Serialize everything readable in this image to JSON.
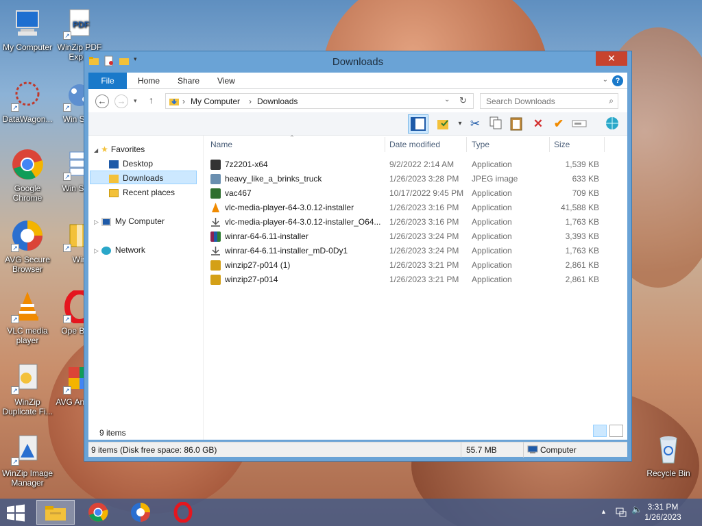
{
  "desktop": {
    "icons": [
      {
        "label": "My Computer",
        "icon": "computer-icon"
      },
      {
        "label": "WinZip PDF Expre",
        "icon": "pdf-icon"
      },
      {
        "label": "DataWagon...",
        "icon": "datawagon-icon"
      },
      {
        "label": "Win Safe",
        "icon": "winzip-safe-icon"
      },
      {
        "label": "Google Chrome",
        "icon": "chrome-icon"
      },
      {
        "label": "Win Secu",
        "icon": "winzip-secure-icon"
      },
      {
        "label": "AVG Secure Browser",
        "icon": "avg-browser-icon"
      },
      {
        "label": "Win",
        "icon": "winzip-icon"
      },
      {
        "label": "VLC media player",
        "icon": "vlc-icon"
      },
      {
        "label": "Ope Brow",
        "icon": "opera-icon"
      },
      {
        "label": "WinZip Duplicate Fi...",
        "icon": "winzip-duplicate-icon"
      },
      {
        "label": "AVG An FRE",
        "icon": "avg-antivirus-icon"
      },
      {
        "label": "WinZip Image Manager",
        "icon": "winzip-image-icon"
      },
      {
        "label": "Recycle Bin",
        "icon": "recycle-bin-icon"
      }
    ]
  },
  "window": {
    "title": "Downloads",
    "close": "✕",
    "ribbon_tabs": [
      "File",
      "Home",
      "Share",
      "View"
    ],
    "help": "?",
    "address": {
      "crumbs": [
        "My Computer",
        "Downloads"
      ]
    },
    "search": {
      "placeholder": "Search Downloads"
    },
    "nav": {
      "favorites": "Favorites",
      "desktop": "Desktop",
      "downloads": "Downloads",
      "recent": "Recent places",
      "computer": "My Computer",
      "network": "Network"
    },
    "columns": [
      "Name",
      "Date modified",
      "Type",
      "Size"
    ],
    "files": [
      {
        "name": "7z2201-x64",
        "date": "9/2/2022 2:14 AM",
        "type": "Application",
        "size": "1,539 KB",
        "color": "#333333"
      },
      {
        "name": "heavy_like_a_brinks_truck",
        "date": "1/26/2023 3:28 PM",
        "type": "JPEG image",
        "size": "633 KB",
        "color": "#6a8fb0"
      },
      {
        "name": "vac467",
        "date": "10/17/2022 9:45 PM",
        "type": "Application",
        "size": "709 KB",
        "color": "#2f6f2f"
      },
      {
        "name": "vlc-media-player-64-3.0.12-installer",
        "date": "1/26/2023 3:16 PM",
        "type": "Application",
        "size": "41,588 KB",
        "color": "#f08a00"
      },
      {
        "name": "vlc-media-player-64-3.0.12-installer_O64...",
        "date": "1/26/2023 3:16 PM",
        "type": "Application",
        "size": "1,763 KB",
        "color": "#888888"
      },
      {
        "name": "winrar-64-6.11-installer",
        "date": "1/26/2023 3:24 PM",
        "type": "Application",
        "size": "3,393 KB",
        "color": "#8b2252"
      },
      {
        "name": "winrar-64-6.11-installer_mD-0Dy1",
        "date": "1/26/2023 3:24 PM",
        "type": "Application",
        "size": "1,763 KB",
        "color": "#888888"
      },
      {
        "name": "winzip27-p014 (1)",
        "date": "1/26/2023 3:21 PM",
        "type": "Application",
        "size": "2,861 KB",
        "color": "#d4a017"
      },
      {
        "name": "winzip27-p014",
        "date": "1/26/2023 3:21 PM",
        "type": "Application",
        "size": "2,861 KB",
        "color": "#d4a017"
      }
    ],
    "item_count": "9 items",
    "status": {
      "summary": "9 items (Disk free space: 86.0 GB)",
      "size": "55.7 MB",
      "location": "Computer"
    }
  },
  "taskbar": {
    "clock_time": "3:31 PM",
    "clock_date": "1/26/2023",
    "apps": [
      "file-explorer-icon",
      "chrome-icon",
      "avg-browser-icon",
      "opera-icon"
    ]
  }
}
